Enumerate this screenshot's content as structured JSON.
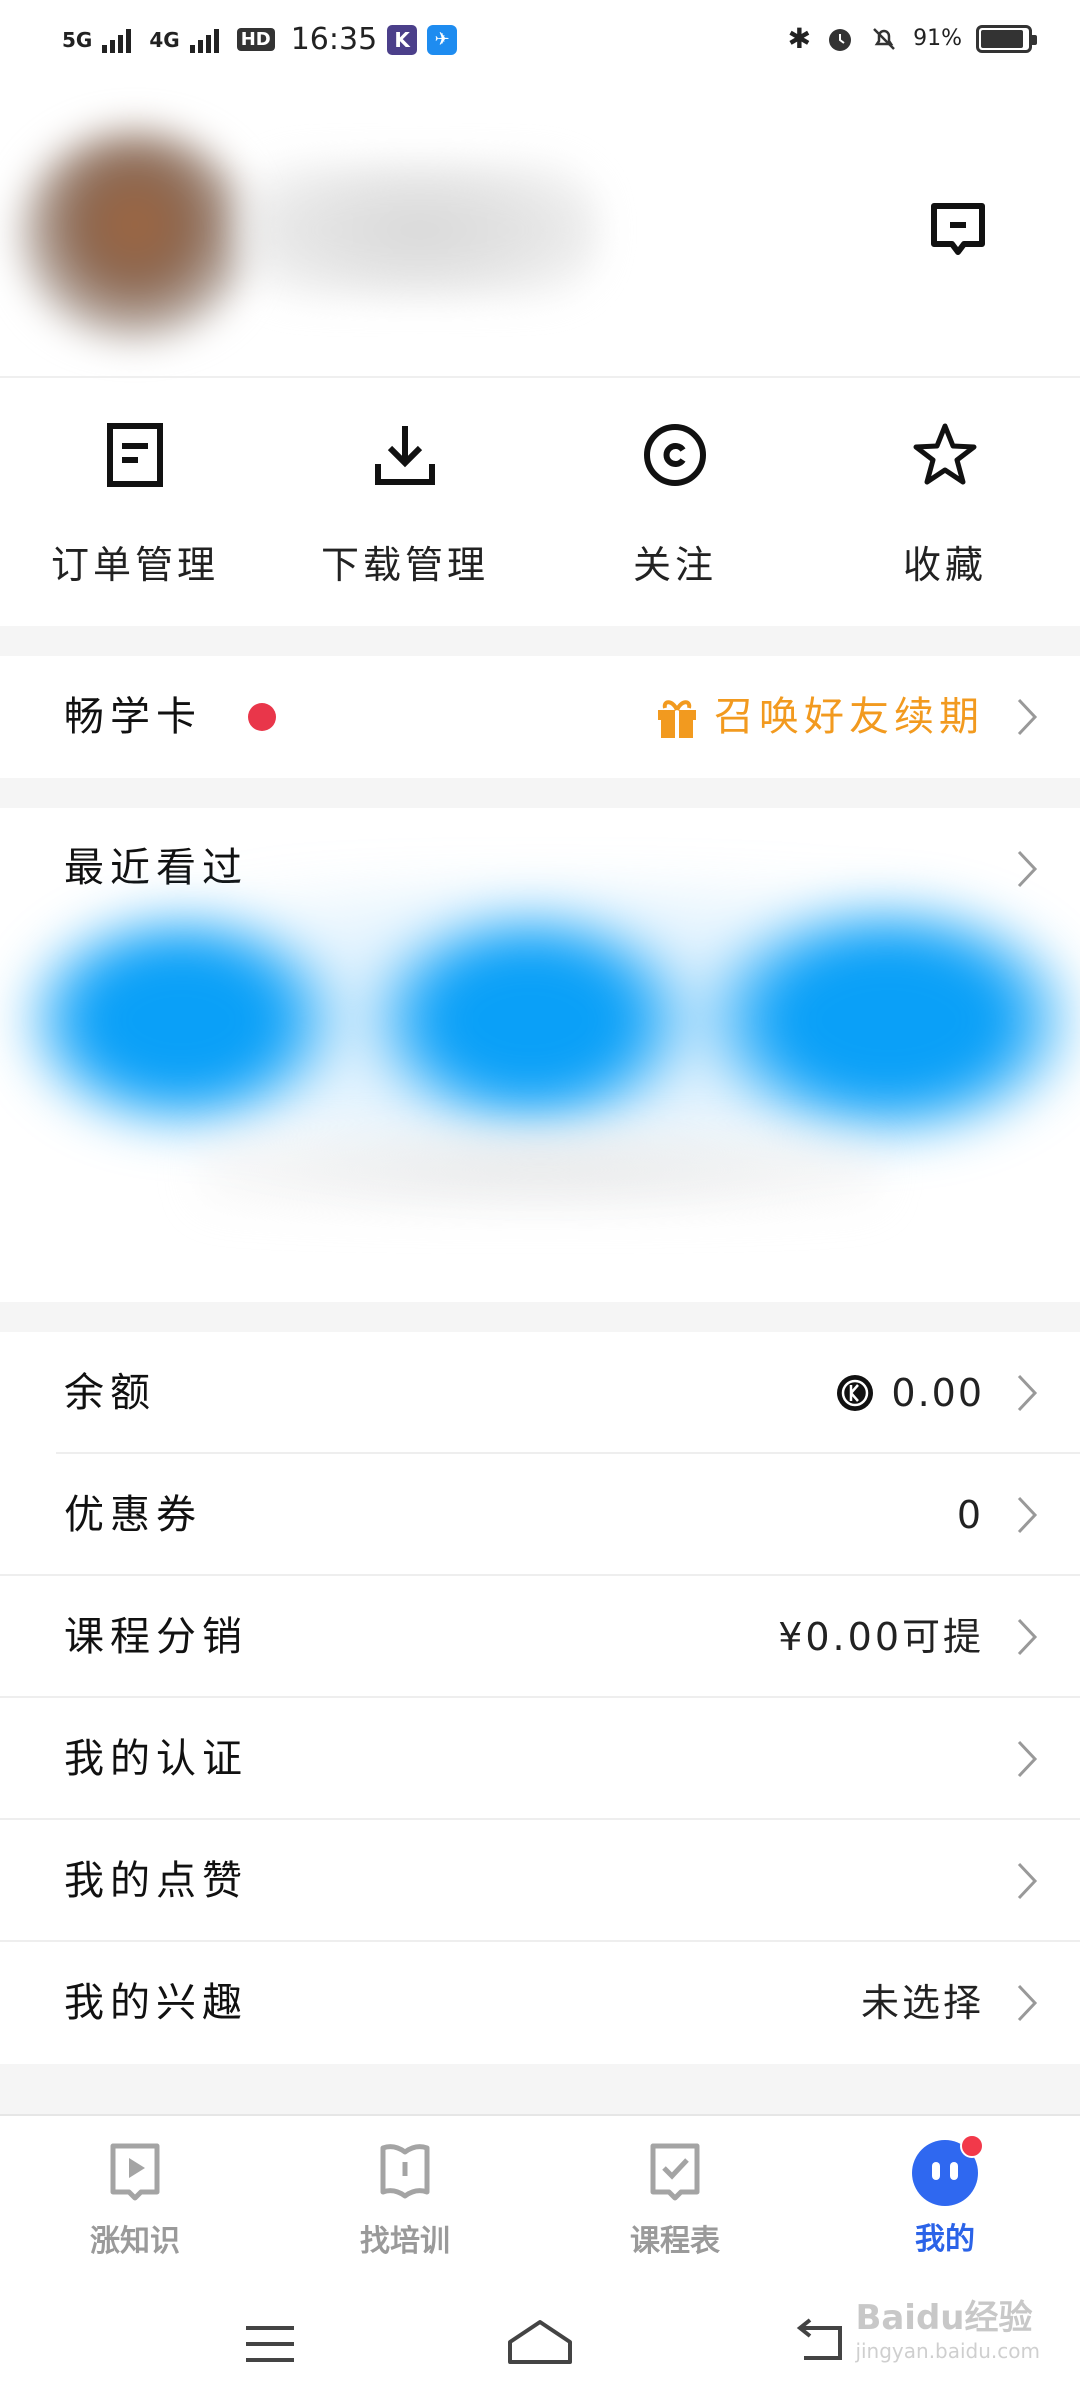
{
  "status_bar": {
    "network_1": "5G",
    "network_2": "4G",
    "hd": "HD",
    "time": "16:35",
    "battery_text": "91%",
    "battery_level": 0.91
  },
  "header": {
    "message_icon": "message-square-icon"
  },
  "quick_actions": [
    {
      "label": "订单管理",
      "icon": "order-icon"
    },
    {
      "label": "下载管理",
      "icon": "download-icon"
    },
    {
      "label": "关注",
      "icon": "follow-eye-icon"
    },
    {
      "label": "收藏",
      "icon": "star-icon"
    }
  ],
  "changxue": {
    "title": "畅学卡",
    "promo": "召唤好友续期",
    "promo_color": "#f29a1f"
  },
  "recent": {
    "title": "最近看过"
  },
  "menu": [
    {
      "title": "余额",
      "value": "0.00"
    },
    {
      "title": "优惠券",
      "value": "0"
    },
    {
      "title": "课程分销",
      "value": "¥0.00可提"
    },
    {
      "title": "我的认证",
      "value": ""
    },
    {
      "title": "我的点赞",
      "value": ""
    },
    {
      "title": "我的兴趣",
      "value": "未选择"
    }
  ],
  "tabs": [
    {
      "label": "涨知识",
      "icon": "play-card-icon"
    },
    {
      "label": "找培训",
      "icon": "book-card-icon"
    },
    {
      "label": "课程表",
      "icon": "check-card-icon"
    },
    {
      "label": "我的",
      "icon": "face-icon"
    }
  ],
  "colors": {
    "accent": "#2b63e8",
    "inactive": "#9a9a9a",
    "red_dot": "#e9364a"
  },
  "watermark": {
    "brand": "Baidu经验",
    "url": "jingyan.baidu.com"
  }
}
